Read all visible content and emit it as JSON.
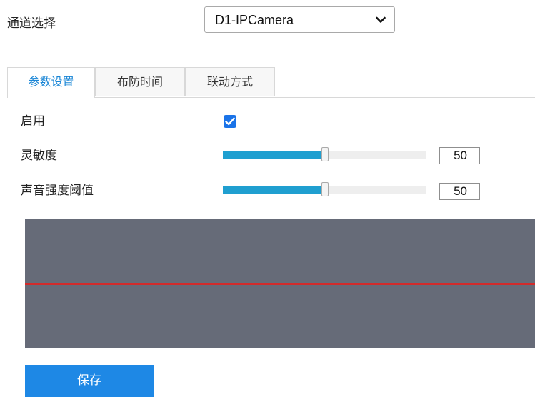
{
  "channel": {
    "label": "通道选择",
    "selected": "D1-IPCamera",
    "dropdown_icon": "chevron-down-icon"
  },
  "tabs": [
    {
      "label": "参数设置",
      "active": true
    },
    {
      "label": "布防时间",
      "active": false
    },
    {
      "label": "联动方式",
      "active": false
    }
  ],
  "settings": {
    "enable": {
      "label": "启用",
      "checked": true,
      "icon": "checkmark-icon"
    },
    "sensitivity": {
      "label": "灵敏度",
      "value": "50",
      "level_percent": 50
    },
    "threshold": {
      "label": "声音强度阈值",
      "value": "50",
      "level_percent": 50
    }
  },
  "save_label": "保存",
  "colors": {
    "accent": "#1e88e5",
    "slider_fill": "#1f9fd0",
    "wave_background": "#666b78",
    "threshold_line": "#d22b2b",
    "active_tab_text": "#1a86d6"
  }
}
